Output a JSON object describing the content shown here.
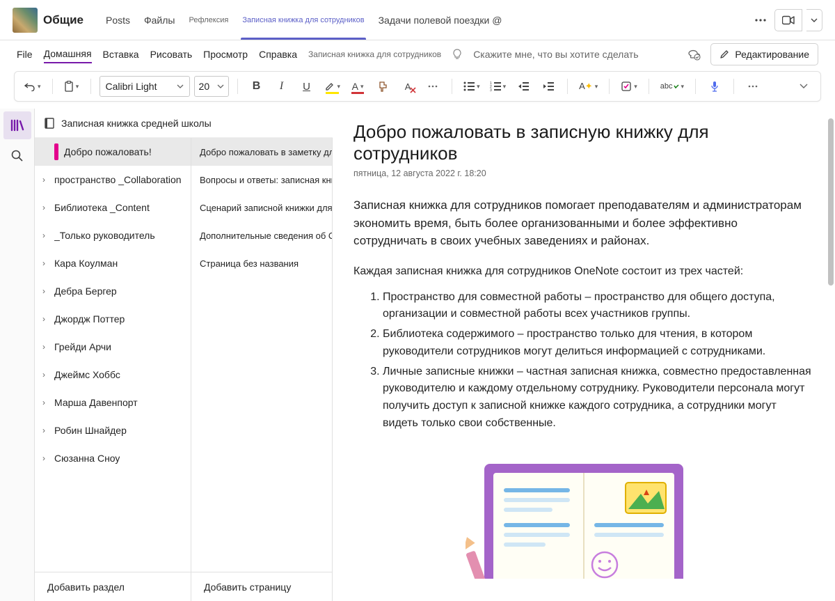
{
  "team": {
    "name": "Общие"
  },
  "topTabs": [
    {
      "label": "Posts",
      "small": false
    },
    {
      "label": "Файлы",
      "small": false
    },
    {
      "label": "Рефлексия",
      "small": true
    },
    {
      "label": "Записная книжка для сотрудников",
      "small": true,
      "active": true
    },
    {
      "label": "Задачи полевой поездки @",
      "small": false
    }
  ],
  "ribbon": {
    "items": [
      {
        "label": "File"
      },
      {
        "label": "Домашняя",
        "active": true
      },
      {
        "label": "Вставка"
      },
      {
        "label": "Рисовать"
      },
      {
        "label": "Просмотр"
      },
      {
        "label": "Справка"
      },
      {
        "label": "Записная книжка для сотрудников",
        "small": true
      }
    ],
    "tellMe": "Скажите мне, что вы хотите сделать",
    "editLabel": "Редактирование"
  },
  "toolbar": {
    "fontName": "Calibri Light",
    "fontSize": "20"
  },
  "notebook": {
    "title": "Записная книжка средней школы",
    "sections": [
      {
        "label": "Добро пожаловать!",
        "selected": true,
        "color": "pink",
        "expand": false
      },
      {
        "label": "пространство _Collaboration",
        "expand": true
      },
      {
        "label": "Библиотека _Content",
        "expand": true
      },
      {
        "label": "_Только руководитель",
        "expand": true
      },
      {
        "label": "Кара Коулман",
        "expand": true
      },
      {
        "label": "Дебра Бергер",
        "expand": true
      },
      {
        "label": "Джордж Поттер",
        "expand": true
      },
      {
        "label": "Грейди Арчи",
        "expand": true
      },
      {
        "label": "Джеймс Хоббс",
        "expand": true
      },
      {
        "label": "Марша Давенпорт",
        "expand": true
      },
      {
        "label": "Робин Шнайдер",
        "expand": true
      },
      {
        "label": "Сюзанна Сноу",
        "expand": true
      }
    ],
    "pages": [
      {
        "label": "Добро пожаловать в заметку для сотрудников",
        "selected": true
      },
      {
        "label": "Вопросы и ответы: записная книжка для сотрудников в ..."
      },
      {
        "label": "Сценарий записной книжки для сотрудников..."
      },
      {
        "label": "Дополнительные сведения об One"
      },
      {
        "label": "Страница без названия"
      }
    ],
    "addSection": "Добавить раздел",
    "addPage": "Добавить страницу"
  },
  "page": {
    "title": "Добро пожаловать в записную книжку для сотрудников",
    "date": "пятница, 12 августа 2022 г. 18:20",
    "intro": "Записная книжка для сотрудников помогает преподавателям и администраторам экономить время, быть более организованными и более эффективно сотрудничать в своих учебных заведениях и районах.",
    "sub": "Каждая записная книжка для сотрудников OneNote состоит из трех частей:",
    "list": [
      "Пространство для совместной работы – пространство для общего доступа, организации и совместной работы всех участников группы.",
      "Библиотека содержимого – пространство только для чтения, в котором руководители сотрудников могут делиться информацией с сотрудниками.",
      "Личные записные книжки – частная записная книжка, совместно предоставленная руководителю и каждому отдельному сотруднику. Руководители персонала могут получить доступ к записной книжке каждого сотрудника, а сотрудники могут видеть только свои собственные."
    ]
  }
}
